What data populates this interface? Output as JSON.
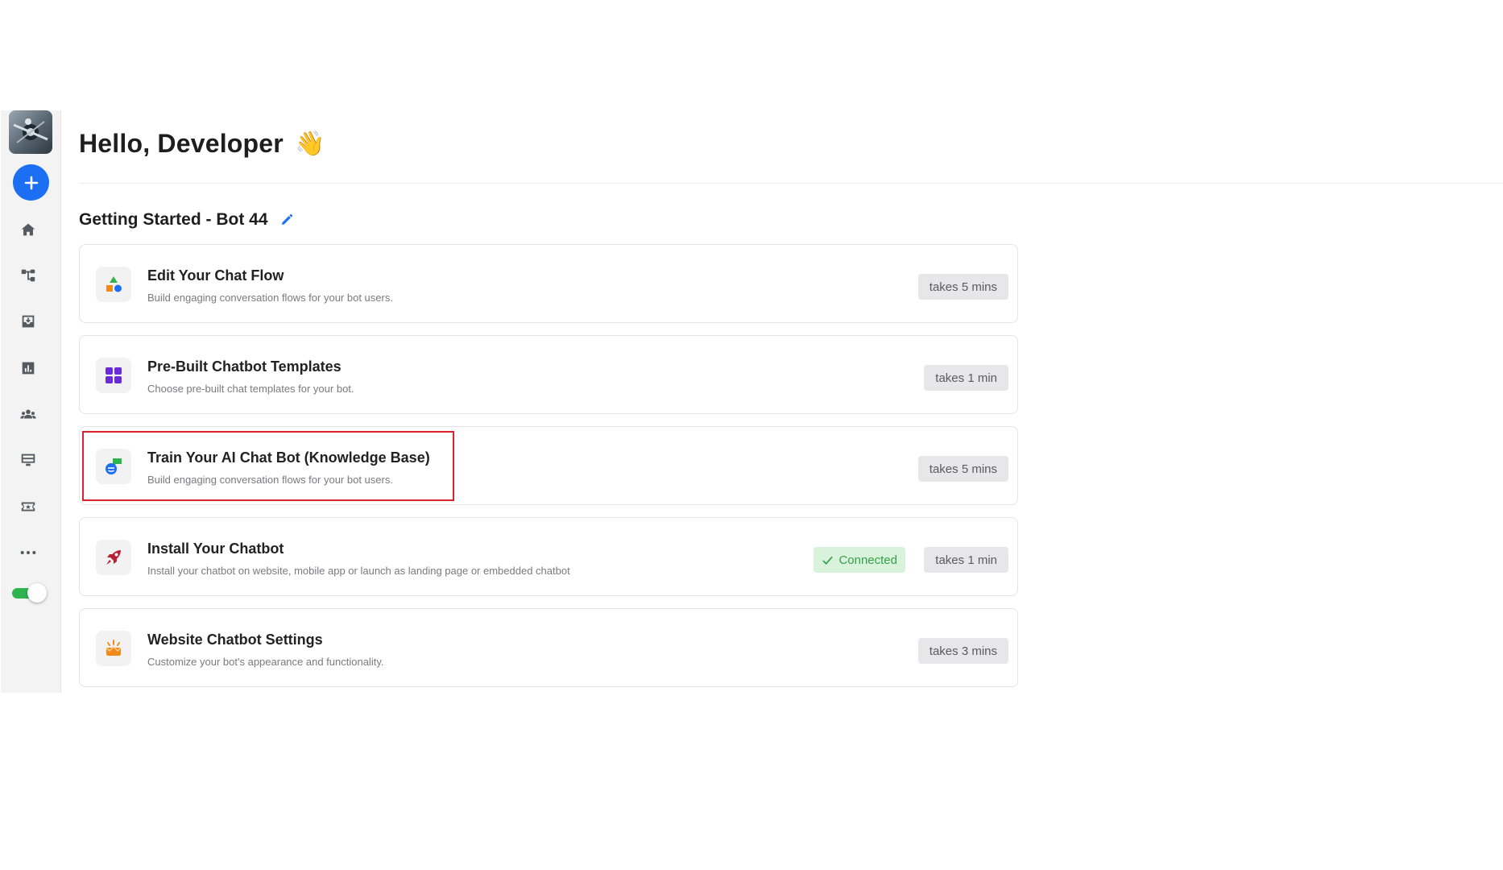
{
  "header": {
    "greeting": "Hello, Developer",
    "wave_emoji": "👋"
  },
  "section": {
    "title": "Getting Started - Bot 44",
    "edit_icon": "pencil-icon"
  },
  "sidebar": {
    "avatar": "bot-avatar",
    "add_icon": "plus-icon",
    "items": [
      {
        "icon": "home-icon"
      },
      {
        "icon": "flow-icon"
      },
      {
        "icon": "inbox-icon"
      },
      {
        "icon": "analytics-icon"
      },
      {
        "icon": "users-icon"
      },
      {
        "icon": "monitor-icon"
      },
      {
        "icon": "ticket-icon"
      },
      {
        "icon": "more-icon"
      }
    ],
    "toggle_on": true
  },
  "cards": [
    {
      "title": "Edit Your Chat Flow",
      "description": "Build engaging conversation flows for your bot users.",
      "time": "takes 5 mins",
      "icon": "shapes-icon"
    },
    {
      "title": "Pre-Built Chatbot Templates",
      "description": "Choose pre-built chat templates for your bot.",
      "time": "takes 1 min",
      "icon": "grid-icon"
    },
    {
      "title": "Train Your AI Chat Bot (Knowledge Base)",
      "description": "Build engaging conversation flows for your bot users.",
      "time": "takes 5 mins",
      "icon": "chat-bubbles-icon"
    },
    {
      "title": "Install Your Chatbot",
      "description": "Install your chatbot on website, mobile app or launch as landing page or embedded chatbot",
      "time": "takes 1 min",
      "status": "Connected",
      "icon": "rocket-icon"
    },
    {
      "title": "Website Chatbot Settings",
      "description": "Customize your bot's appearance and functionality.",
      "time": "takes 3 mins",
      "icon": "crown-icon"
    }
  ],
  "colors": {
    "accent": "#1c6ef2",
    "connected_bg": "#d9f2dc",
    "connected_text": "#34a048",
    "highlight": "#d8232f",
    "toggle_on": "#2fb34f"
  }
}
